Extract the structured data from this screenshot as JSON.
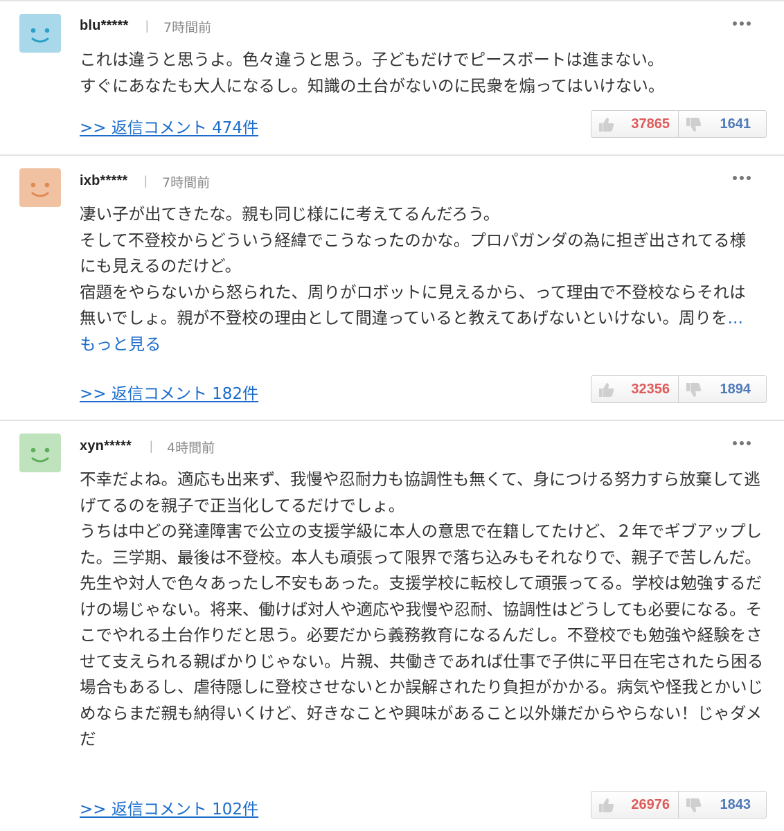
{
  "colors": {
    "link": "#1a6ccc",
    "like_count": "#e05a5a",
    "dislike_count": "#4f79b8",
    "divider": "#e3e3e3"
  },
  "comments": [
    {
      "avatar_color": "#a9d8ea",
      "username": "blu*****",
      "separator": "|",
      "timestamp": "7時間前",
      "text": "これは違うと思うよ。色々違うと思う。子どもだけでピースボートは進まない。\nすぐにあなたも大人になるし。知識の土台がないのに民衆を煽ってはいけない。",
      "more_link": "",
      "reply_link": ">> 返信コメント 474件",
      "likes": "37865",
      "dislikes": "1641"
    },
    {
      "avatar_color": "#f0c2a2",
      "username": "ixb*****",
      "separator": "|",
      "timestamp": "7時間前",
      "text": "凄い子が出てきたな。親も同じ様にに考えてるんだろう。\nそして不登校からどういう経緯でこうなったのかな。プロパガンダの為に担ぎ出されてる様にも見えるのだけど。\n宿題をやらないから怒られた、周りがロボットに見えるから、って理由で不登校ならそれは無いでしょ。親が不登校の理由として間違っていると教えてあげないといけない。周りを",
      "more_link": "...もっと見る",
      "reply_link": ">> 返信コメント 182件",
      "likes": "32356",
      "dislikes": "1894"
    },
    {
      "avatar_color": "#bfe3bd",
      "username": "xyn*****",
      "separator": "|",
      "timestamp": "4時間前",
      "text": "不幸だよね。適応も出来ず、我慢や忍耐力も協調性も無くて、身につける努力すら放棄して逃げてるのを親子で正当化してるだけでしょ。\nうちは中どの発達障害で公立の支援学級に本人の意思で在籍してたけど、２年でギブアップした。三学期、最後は不登校。本人も頑張って限界で落ち込みもそれなりで、親子で苦しんだ。先生や対人で色々あったし不安もあった。支援学校に転校して頑張ってる。学校は勉強するだけの場じゃない。将来、働けば対人や適応や我慢や忍耐、協調性はどうしても必要になる。そこでやれる土台作りだと思う。必要だから義務教育になるんだし。不登校でも勉強や経験をさせて支えられる親ばかりじゃない。片親、共働きであれば仕事で子供に平日在宅されたら困る場合もあるし、虐待隠しに登校させないとか誤解されたり負担がかかる。病気や怪我とかいじめならまだ親も納得いくけど、好きなことや興味があること以外嫌だからやらない！じゃダメだ",
      "more_link": "",
      "reply_link": ">> 返信コメント 102件",
      "likes": "26976",
      "dislikes": "1843"
    }
  ],
  "icons": {
    "more": "more-dots-icon",
    "like": "thumbs-up-icon",
    "dislike": "thumbs-down-icon",
    "avatar": "smiley-face-icon"
  }
}
